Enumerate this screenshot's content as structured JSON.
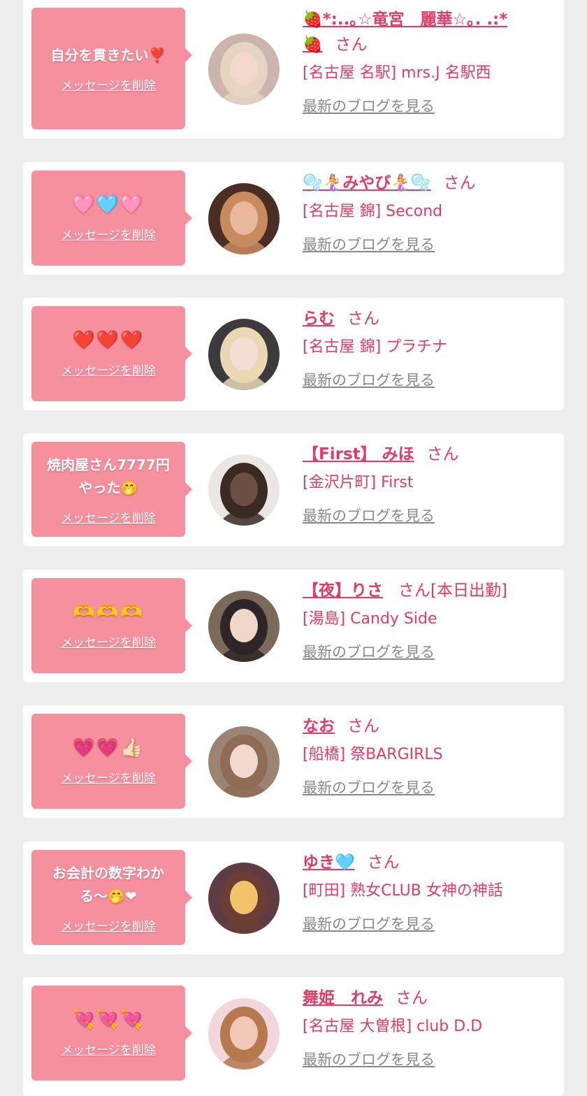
{
  "accent_color": "#e23b66",
  "bubble_color": "#f7909e",
  "delete_label": "メッセージを削除",
  "blog_label": "最新のブログを見る",
  "san_label": "さん",
  "cards": [
    {
      "message": "自分を貫きたい❣️",
      "name": "🍓*:..｡☆竜宮　麗華☆｡. .:*\n🍓",
      "suffix": "",
      "shop": "[名古屋 名駅] mrs.J 名駅西",
      "avatar": {
        "bg": "#cbb4ac",
        "skin": "#f1d7cc",
        "hair": "#e6d3c2",
        "name": "girl-photo-1"
      }
    },
    {
      "message": "🩷🩵🩷",
      "name": "🫧🧜‍♀️みやび🧜‍♀️🫧",
      "suffix": "",
      "shop": "[名古屋 錦] Second",
      "avatar": {
        "bg": "#4a2e24",
        "skin": "#e7b89c",
        "hair": "#c88a5e",
        "name": "girl-photo-2"
      }
    },
    {
      "message": "❤️❤️❤️",
      "name": "らむ",
      "suffix": "",
      "shop": "[名古屋 錦] プラチナ",
      "avatar": {
        "bg": "#3c3a3c",
        "skin": "#f4ddd2",
        "hair": "#ead8b5",
        "name": "girl-photo-3"
      }
    },
    {
      "message": "焼肉屋さん7777円\nやった🤭",
      "name": "【First】 みほ",
      "suffix": "",
      "shop": "[金沢片町] First",
      "avatar": {
        "bg": "#e9e6e4",
        "skin": "#6b4f44",
        "hair": "#3a2a24",
        "name": "hair-back-photo"
      }
    },
    {
      "message": "🫶🫶🫶",
      "name": "【夜】りさ",
      "suffix": "[本日出勤]",
      "shop": "[湯島] Candy Side",
      "avatar": {
        "bg": "#7a6a5a",
        "skin": "#efd7c9",
        "hair": "#2f2526",
        "name": "girl-photo-5"
      }
    },
    {
      "message": "💗💗👍🏻",
      "name": "なお",
      "suffix": "",
      "shop": "[船橋] 祭BARGIRLS",
      "avatar": {
        "bg": "#9c8372",
        "skin": "#f3d8cd",
        "hair": "#8f6c55",
        "name": "girl-photo-6"
      }
    },
    {
      "message": "お会計の数字わか\nる〜🤭❤",
      "name": "ゆき🩵",
      "suffix": "",
      "shop": "[町田] 熟女CLUB 女神の神話",
      "avatar": {
        "bg": "#5d3c44",
        "skin": "#f2c36b",
        "hair": "#6a3d35",
        "name": "girl-photo-7"
      }
    },
    {
      "message": "💘💘💘",
      "name": "舞姫　れみ",
      "suffix": "",
      "shop": "[名古屋 大曽根] club D.D",
      "avatar": {
        "bg": "#f1d6dc",
        "skin": "#f0c9b8",
        "hair": "#b6784d",
        "name": "girl-photo-8"
      }
    }
  ]
}
